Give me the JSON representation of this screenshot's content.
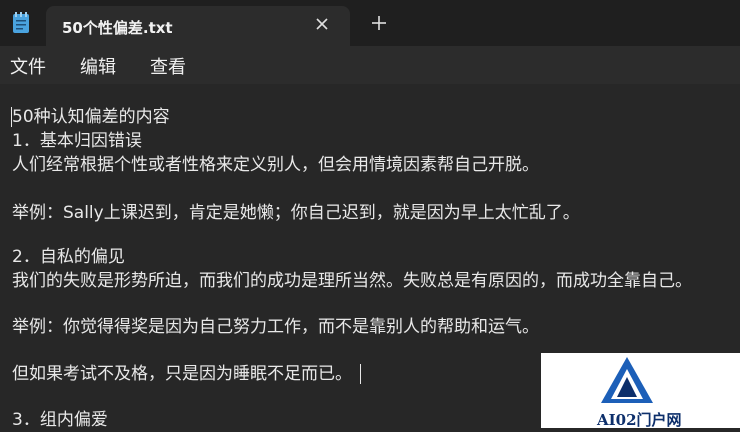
{
  "tab": {
    "title": "50个性偏差.txt"
  },
  "menu": [
    "文件",
    "编辑",
    "查看"
  ],
  "lines": [
    "50种认知偏差的内容",
    "1．基本归因错误",
    "人们经常根据个性或者性格来定义别人，但会用情境因素帮自己开脱。",
    "",
    "举例：Sally上课迟到，肯定是她懒；你自己迟到，就是因为早上太忙乱了。",
    "",
    "2．自私的偏见",
    "我们的失败是形势所迫，而我们的成功是理所当然。失败总是有原因的，而成功全靠自己。",
    "",
    "举例：你觉得得奖是因为自己努力工作，而不是靠别人的帮助和运气。",
    "",
    "但如果考试不及格，只是因为睡眠不足而已。",
    "",
    "3．组内偏爱"
  ],
  "watermark": {
    "text": "AI02门户网",
    "colors": [
      "#1c5fb8",
      "#0d2f6b"
    ]
  },
  "colors": {
    "background": "#272727",
    "tabbar": "#1f1f1f",
    "text": "#e8e8e8"
  }
}
